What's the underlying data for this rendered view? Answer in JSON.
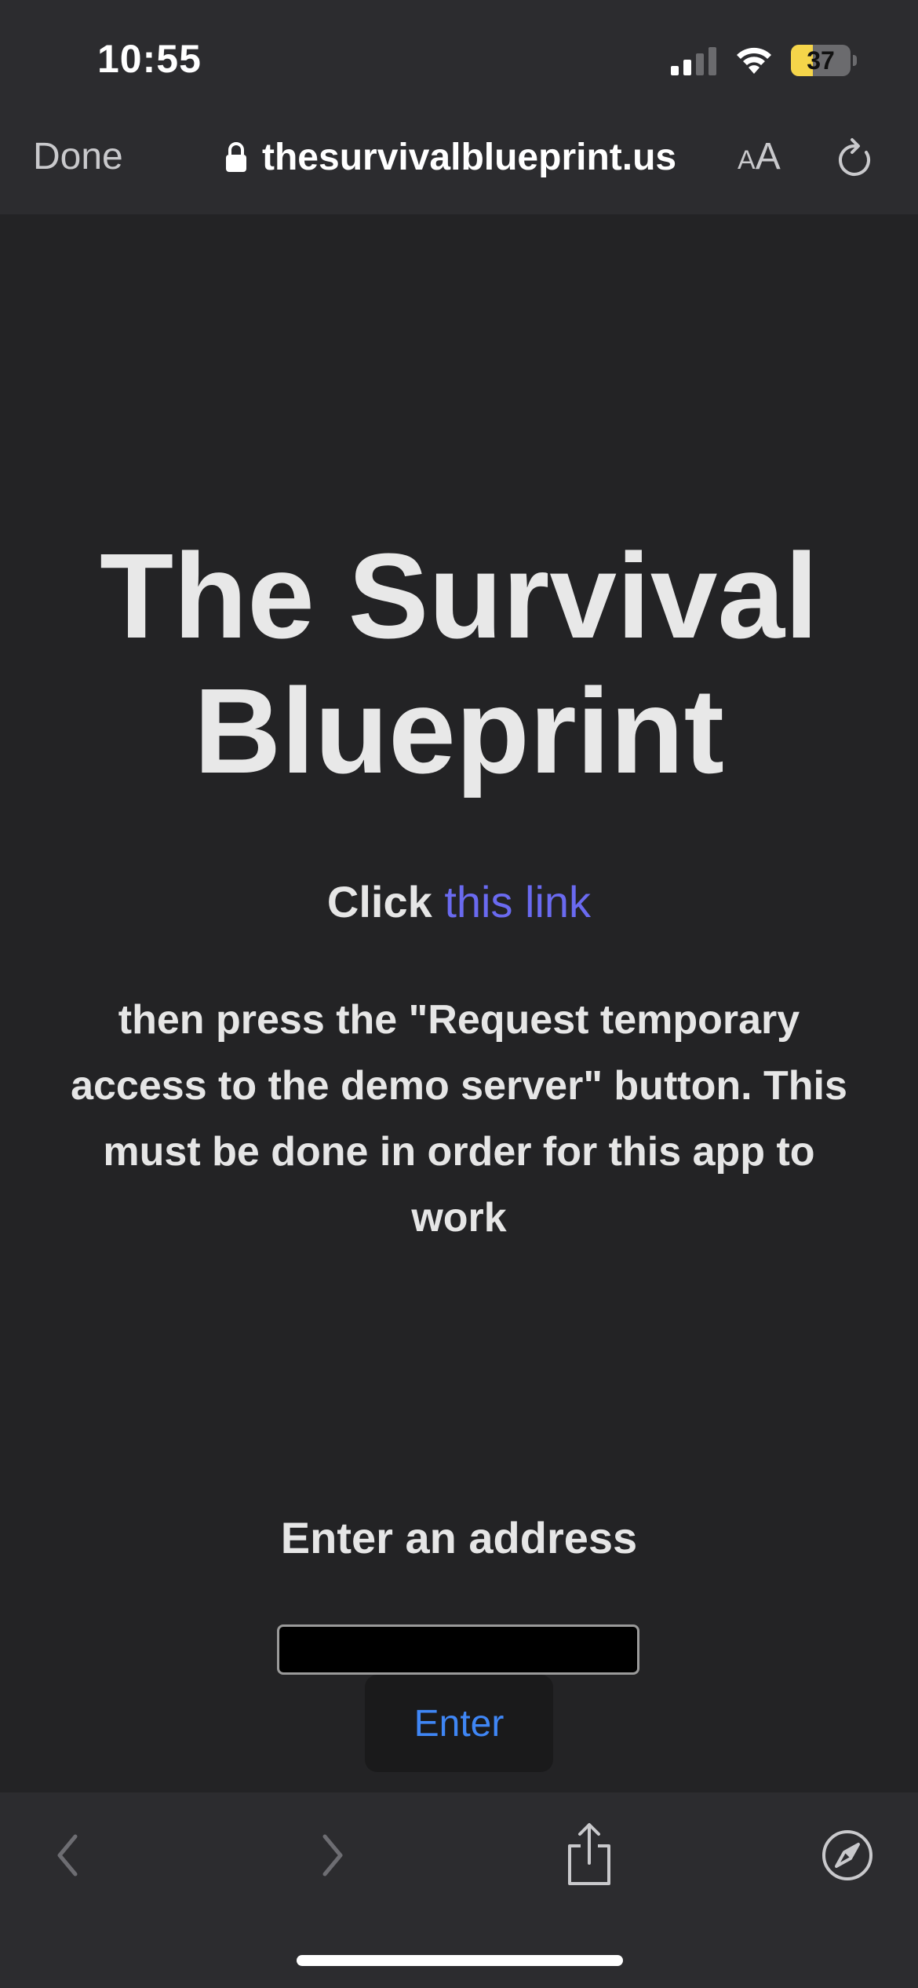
{
  "status_bar": {
    "time": "10:55",
    "battery_level": "37",
    "battery_fraction": 0.37
  },
  "browser": {
    "done_label": "Done",
    "url": "thesurvivalblueprint.us",
    "text_size_small": "A",
    "text_size_large": "A"
  },
  "page": {
    "title": "The Survival Blueprint",
    "click_prefix": "Click ",
    "link_text": "this link",
    "instructions": "then press the \"Request temporary access to the demo server\" button. This must be done in order for this app to work",
    "address_label": "Enter an address",
    "address_value": "",
    "enter_label": "Enter"
  },
  "colors": {
    "link": "#6a6af0",
    "button_text": "#3f86f5",
    "battery_fill": "#f5d54a"
  },
  "icons": {
    "signal": "cellular-signal-icon",
    "wifi": "wifi-icon",
    "lock": "lock-icon",
    "reload": "reload-icon",
    "back": "chevron-left-icon",
    "forward": "chevron-right-icon",
    "share": "share-icon",
    "compass": "compass-icon"
  }
}
